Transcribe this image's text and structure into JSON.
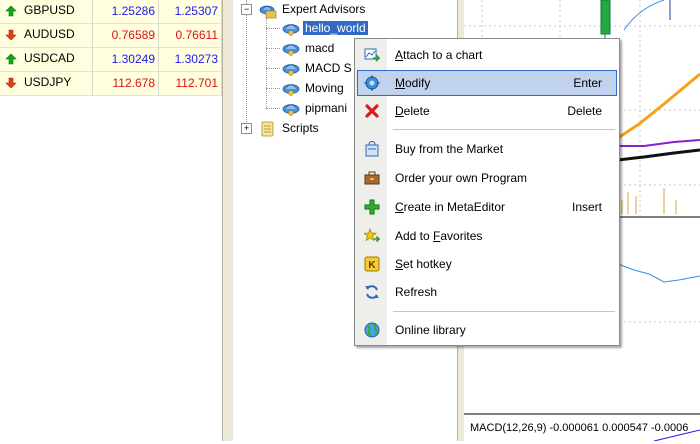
{
  "market_watch": {
    "rows": [
      {
        "symbol": "GBPUSD",
        "bid": "1.25286",
        "ask": "1.25307",
        "direction": "up",
        "color": "#1a1aee"
      },
      {
        "symbol": "AUDUSD",
        "bid": "0.76589",
        "ask": "0.76611",
        "direction": "down",
        "color": "#e01010"
      },
      {
        "symbol": "USDCAD",
        "bid": "1.30249",
        "ask": "1.30273",
        "direction": "up",
        "color": "#1a1aee"
      },
      {
        "symbol": "USDJPY",
        "bid": "112.678",
        "ask": "112.701",
        "direction": "down",
        "color": "#e01010"
      }
    ]
  },
  "navigator": {
    "expert_advisors": "Expert Advisors",
    "items": [
      "hello_world",
      "macd",
      "MACD S",
      "Moving",
      "pipmani"
    ],
    "scripts": "Scripts",
    "selected": "hello_world"
  },
  "chart": {
    "indicator_label": "MACD(12,26,9) -0.000061 0.000547 -0.0006"
  },
  "context_menu": {
    "items": [
      {
        "label_u": "A",
        "label_rest": "ttach to a chart",
        "shortcut": "",
        "icon": "attach-chart-icon"
      },
      {
        "label_u": "M",
        "label_rest": "odify",
        "shortcut": "Enter",
        "icon": "modify-gear-icon"
      },
      {
        "label_u": "D",
        "label_rest": "elete",
        "shortcut": "Delete",
        "icon": "delete-x-icon"
      },
      {
        "label_u": "",
        "label_rest": "Buy from the Market",
        "shortcut": "",
        "icon": "market-bag-icon"
      },
      {
        "label_u": "",
        "label_rest": "Order your own Program",
        "shortcut": "",
        "icon": "briefcase-icon"
      },
      {
        "label_u": "C",
        "label_rest": "reate in MetaEditor",
        "shortcut": "Insert",
        "icon": "plus-icon"
      },
      {
        "label_pre": "Add to ",
        "label_u": "F",
        "label_rest": "avorites",
        "shortcut": "",
        "icon": "favorites-star-icon"
      },
      {
        "label_u": "S",
        "label_rest": "et hotkey",
        "shortcut": "",
        "icon": "hotkey-k-icon"
      },
      {
        "label_u": "",
        "label_rest": "Refresh",
        "shortcut": "",
        "icon": "refresh-icon"
      },
      {
        "label_u": "",
        "label_rest": "Online library",
        "shortcut": "",
        "icon": "globe-icon"
      }
    ],
    "highlighted": "Modify"
  },
  "colors": {
    "selection": "#316ac5",
    "menu_highlight": "#c1d2ee",
    "quote_cell": "#ffffe0"
  }
}
